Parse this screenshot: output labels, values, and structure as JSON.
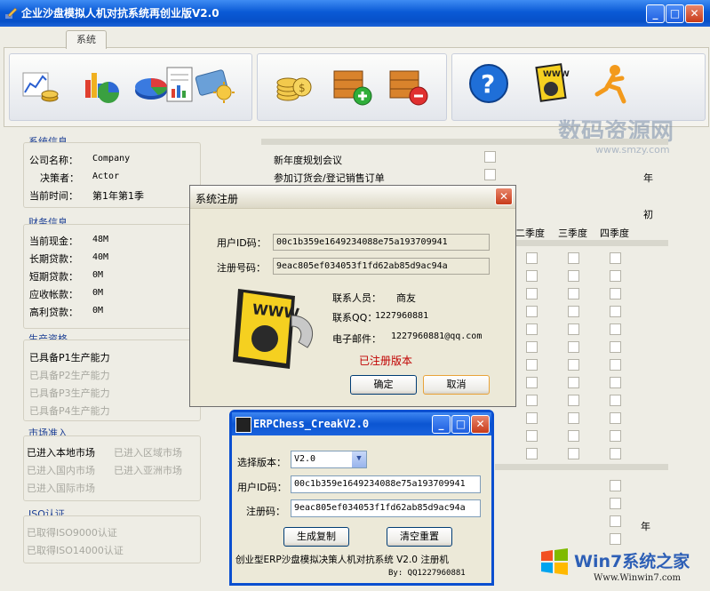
{
  "window": {
    "title": "企业沙盘模拟人机对抗系统再创业版V2.0",
    "tab": "系统"
  },
  "toolbar": {
    "groups": [
      {
        "icons": [
          "chart-gold-icon",
          "bar-pie-chart-icon",
          "pie-chart-icon",
          "document-chart-icon",
          "film-sun-icon"
        ]
      },
      {
        "icons": [
          "coins-icon",
          "crate-add-icon",
          "crate-remove-icon"
        ]
      },
      {
        "icons": [
          "help-icon",
          "www-registration-icon",
          "runner-icon"
        ]
      }
    ]
  },
  "system_info": {
    "title": "系统信息",
    "company_label": "公司名称：",
    "company_value": "Company",
    "decider_label": "决策者：",
    "decider_value": "Actor",
    "time_label": "当前时间：",
    "time_value": "第1年第1季"
  },
  "finance_info": {
    "title": "财务信息",
    "rows": [
      {
        "label": "当前现金：",
        "value": "48M"
      },
      {
        "label": "长期贷款：",
        "value": "40M"
      },
      {
        "label": "短期贷款：",
        "value": "0M"
      },
      {
        "label": "应收帐款：",
        "value": "0M"
      },
      {
        "label": "高利贷款：",
        "value": "0M"
      }
    ]
  },
  "production": {
    "title": "生产资格",
    "items": [
      {
        "label": "已具备P1生产能力",
        "enabled": true
      },
      {
        "label": "已具备P2生产能力",
        "enabled": false
      },
      {
        "label": "已具备P3生产能力",
        "enabled": false
      },
      {
        "label": "已具备P4生产能力",
        "enabled": false
      }
    ]
  },
  "market": {
    "title": "市场准入",
    "items": [
      "已进入本地市场",
      "已进入区域市场",
      "已进入国内市场",
      "已进入亚洲市场",
      "已进入国际市场"
    ]
  },
  "iso": {
    "title": "ISO认证",
    "items": [
      "已取得ISO9000认证",
      "已取得ISO14000认证"
    ]
  },
  "tasks": {
    "items": [
      "新年度规划会议",
      "参加订货会/登记销售订单"
    ],
    "year_label": "年",
    "year_start": "初",
    "quarters": [
      "二季度",
      "三季度",
      "四季度"
    ],
    "end_year_label": "年"
  },
  "register_dialog": {
    "title": "系统注册",
    "user_id_label": "用户ID码：",
    "user_id_value": "00c1b359e1649234088e75a193709941",
    "reg_code_label": "注册号码：",
    "reg_code_value": "9eac805ef034053f1fd62ab85d9ac94a",
    "contact_label": "联系人员：",
    "contact_value": "商友",
    "qq_label": "联系QQ：",
    "qq_value": "1227960881",
    "email_label": "电子邮件：",
    "email_value": "1227960881@qq.com",
    "status": "已注册版本",
    "status_color": "#c00000",
    "ok_label": "确定",
    "cancel_label": "取消"
  },
  "keygen": {
    "title": "ERPChess_CreakV2.0",
    "version_label": "选择版本：",
    "version_value": "V2.0",
    "user_id_label": "用户ID码：",
    "user_id_value": "00c1b359e1649234088e75a193709941",
    "reg_label": "注册码：",
    "reg_value": "9eac805ef034053f1fd62ab85d9ac94a",
    "generate_label": "生成复制",
    "reset_label": "清空重置",
    "footer": "创业型ERP沙盘模拟决策人机对抗系统 V2.0 注册机",
    "by": "By: QQ1227960881"
  },
  "watermarks": {
    "top": "数码资源网",
    "top_url": "www.smzy.com",
    "bottom": "Win7系统之家",
    "bottom_url": "Www.Winwin7.com"
  }
}
